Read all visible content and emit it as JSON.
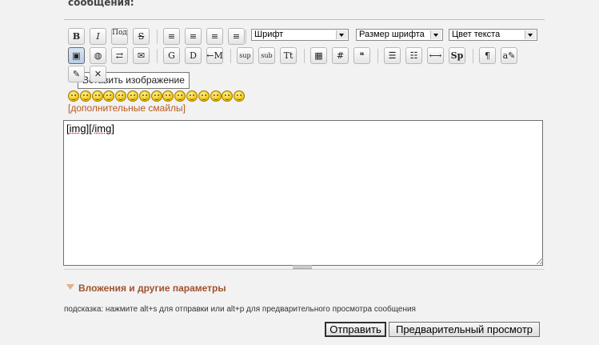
{
  "heading": "сообщения:",
  "toolbar": {
    "row1": [
      {
        "name": "bold-button",
        "glyph": "B"
      },
      {
        "name": "italic-button",
        "glyph": "I"
      },
      {
        "name": "underline-button",
        "glyph": "Под"
      },
      {
        "name": "strikethrough-button",
        "glyph": "S"
      },
      {
        "name": "align-left-button",
        "glyph": "≡"
      },
      {
        "name": "align-justify-button",
        "glyph": "≡"
      },
      {
        "name": "align-center-button",
        "glyph": "≡"
      },
      {
        "name": "align-right-button",
        "glyph": "≡"
      }
    ],
    "font_select": "Шрифт",
    "size_select": "Размер шрифта",
    "color_select": "Цвет текста",
    "row2": [
      {
        "name": "insert-image-button",
        "glyph": "▣"
      },
      {
        "name": "insert-link-button",
        "glyph": "◍"
      },
      {
        "name": "insert-email-button",
        "glyph": "⇄"
      },
      {
        "name": "insert-media-button",
        "glyph": "✉"
      },
      {
        "name": "google-button",
        "glyph": "G"
      },
      {
        "name": "d-button",
        "glyph": "D"
      },
      {
        "name": "hide-button",
        "glyph": "←M"
      },
      {
        "name": "superscript-button",
        "glyph": "sup"
      },
      {
        "name": "subscript-button",
        "glyph": "sub"
      },
      {
        "name": "text-case-button",
        "glyph": "Tt"
      },
      {
        "name": "table-button",
        "glyph": "▦"
      },
      {
        "name": "code-button",
        "glyph": "#"
      },
      {
        "name": "quote-button",
        "glyph": "❝"
      },
      {
        "name": "bullet-list-button",
        "glyph": "☰"
      },
      {
        "name": "numbered-list-button",
        "glyph": "☷"
      },
      {
        "name": "horizontal-rule-button",
        "glyph": "⟷"
      },
      {
        "name": "spoiler-button",
        "glyph": "Sp"
      },
      {
        "name": "paragraph-button",
        "glyph": "¶"
      },
      {
        "name": "edit-note-button",
        "glyph": "a✎"
      }
    ],
    "row3": [
      {
        "name": "translit-button",
        "glyph": "✎"
      },
      {
        "name": "remove-format-button",
        "glyph": "✕"
      }
    ]
  },
  "tooltip": "Вставить изображение",
  "smileys_count": 15,
  "more_smileys": "[дополнительные смайлы]",
  "editor": {
    "prefix": "[",
    "tag1": "img",
    "mid": "][/",
    "tag2": "img",
    "suffix": "]"
  },
  "attachments_label": "Вложения и другие параметры",
  "hint": "подсказка: нажмите alt+s для отправки или alt+p для предварительного просмотра сообщения",
  "buttons": {
    "submit": "Отправить",
    "preview": "Предварительный просмотр"
  }
}
